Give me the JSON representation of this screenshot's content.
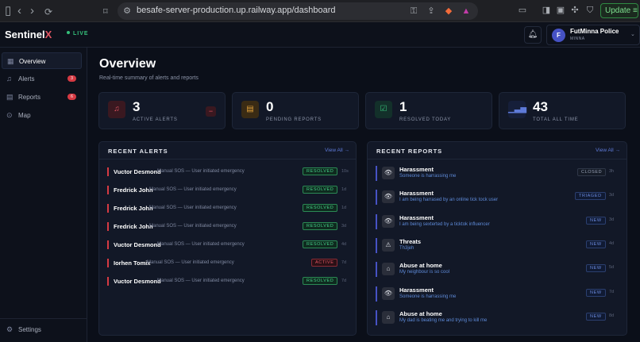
{
  "browser": {
    "url": "besafe-server-production.up.railway.app/dashboard",
    "update_label": "Update"
  },
  "header": {
    "logo_main": "Sentinel",
    "logo_accent": "X",
    "live": "LIVE",
    "user_initial": "F",
    "user_name": "FutMinna Police",
    "user_role": "MINNA"
  },
  "sidebar": {
    "items": [
      {
        "label": "Overview",
        "icon": "grid-icon"
      },
      {
        "label": "Alerts",
        "icon": "bell-icon",
        "badge": "3"
      },
      {
        "label": "Reports",
        "icon": "document-icon",
        "badge": "6"
      },
      {
        "label": "Map",
        "icon": "map-pin-icon"
      }
    ],
    "settings": "Settings"
  },
  "overview": {
    "title": "Overview",
    "subtitle": "Real-time summary of alerts and reports"
  },
  "stats": [
    {
      "value": "3",
      "label": "ACTIVE ALERTS",
      "color": "#e25563",
      "icon": "bell-icon"
    },
    {
      "value": "0",
      "label": "PENDING REPORTS",
      "color": "#e0a03a",
      "icon": "document-icon"
    },
    {
      "value": "1",
      "label": "RESOLVED TODAY",
      "color": "#35c07a",
      "icon": "check-square-icon"
    },
    {
      "value": "43",
      "label": "TOTAL ALL TIME",
      "color": "#5e7ad8",
      "icon": "bar-chart-icon"
    }
  ],
  "alerts": {
    "title": "RECENT ALERTS",
    "view_all": "View All →",
    "rows": [
      {
        "name": "Vuctor Desmond",
        "desc": "Manual SOS — User initiated emergency",
        "status": "RESOLVED",
        "time": "10s"
      },
      {
        "name": "Fredrick John",
        "desc": "Manual SOS — User initiated emergency",
        "status": "RESOLVED",
        "time": "1d"
      },
      {
        "name": "Fredrick John",
        "desc": "Manual SOS — User initiated emergency",
        "status": "RESOLVED",
        "time": "1d"
      },
      {
        "name": "Fredrick John",
        "desc": "Manual SOS — User initiated emergency",
        "status": "RESOLVED",
        "time": "3d"
      },
      {
        "name": "Vuctor Desmond",
        "desc": "Manual SOS — User initiated emergency",
        "status": "RESOLVED",
        "time": "4d"
      },
      {
        "name": "Iorhen Tomix",
        "desc": "Manual SOS — User initiated emergency",
        "status": "ACTIVE",
        "time": "7d"
      },
      {
        "name": "Vuctor Desmond",
        "desc": "Manual SOS — User initiated emergency",
        "status": "RESOLVED",
        "time": "7d"
      }
    ]
  },
  "reports": {
    "title": "RECENT REPORTS",
    "view_all": "View All →",
    "rows": [
      {
        "title": "Harassment",
        "desc": "Someone is harrassing me",
        "status": "CLOSED",
        "time": "3h",
        "icon": "eye-icon"
      },
      {
        "title": "Harassment",
        "desc": "I am being harrased by an online tick tock user",
        "status": "TRIAGED",
        "time": "3d",
        "icon": "eye-icon"
      },
      {
        "title": "Harassment",
        "desc": "I am being sexterted by a ticktok influencer",
        "status": "NEW",
        "time": "3d",
        "icon": "eye-icon"
      },
      {
        "title": "Threats",
        "desc": "Th3jeh",
        "status": "NEW",
        "time": "4d",
        "icon": "warning-icon"
      },
      {
        "title": "Abuse at home",
        "desc": "My neighbour is so cool",
        "status": "NEW",
        "time": "5d",
        "icon": "home-icon"
      },
      {
        "title": "Harassment",
        "desc": "Someone is harrassing me",
        "status": "NEW",
        "time": "7d",
        "icon": "eye-icon"
      },
      {
        "title": "Abuse at home",
        "desc": "My dad is beating me and trying to kill me",
        "status": "NEW",
        "time": "8d",
        "icon": "home-icon"
      }
    ]
  }
}
